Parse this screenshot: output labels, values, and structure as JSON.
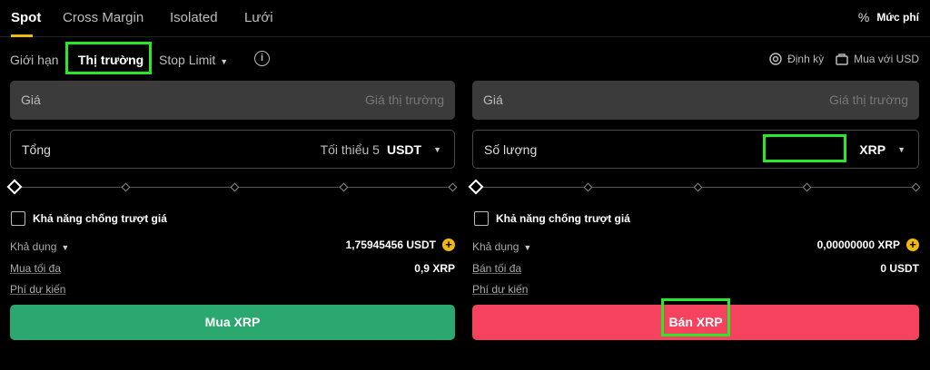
{
  "tabs": [
    {
      "label": "Spot"
    },
    {
      "label": "Cross Margin"
    },
    {
      "label": "Isolated"
    },
    {
      "label": "Lưới"
    }
  ],
  "fee": {
    "icon": "percent-icon",
    "label": "Mức phí"
  },
  "order_types": {
    "limit": "Giới hạn",
    "market": "Thị trường",
    "stop_limit": "Stop Limit"
  },
  "links": {
    "recurring": "Định kỳ",
    "buy_with_usd": "Mua với USD"
  },
  "buy": {
    "price_label": "Giá",
    "price_placeholder": "Giá thị trường",
    "total_label": "Tổng",
    "total_min": "Tối thiểu 5",
    "total_unit": "USDT",
    "slippage_label": "Khả năng chống trượt giá",
    "available_label": "Khả dụng",
    "available_value": "1,75945456 USDT",
    "max_label": "Mua tối đa",
    "max_value": "0,9 XRP",
    "fee_label": "Phí dự kiến",
    "button": "Mua XRP"
  },
  "sell": {
    "price_label": "Giá",
    "price_placeholder": "Giá thị trường",
    "qty_label": "Số lượng",
    "qty_unit": "XRP",
    "slippage_label": "Khả năng chống trượt giá",
    "available_label": "Khả dụng",
    "available_value": "0,00000000 XRP",
    "max_label": "Bán tối đa",
    "max_value": "0 USDT",
    "fee_label": "Phí dự kiến",
    "button": "Bán XRP"
  },
  "colors": {
    "accent": "#f0b90b",
    "buy": "#2aa870",
    "sell": "#f5425e",
    "highlight": "#29e829"
  }
}
